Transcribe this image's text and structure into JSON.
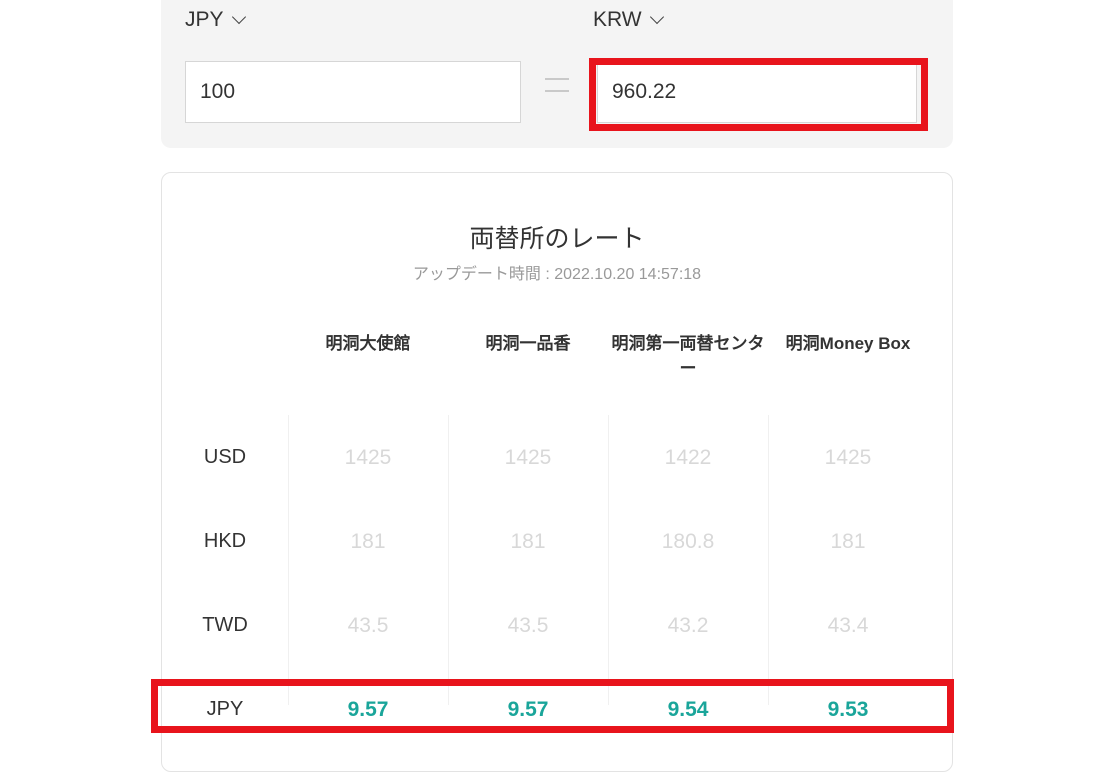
{
  "converter": {
    "from_currency": "JPY",
    "to_currency": "KRW",
    "from_amount": "100",
    "to_amount": "960.22",
    "equals_symbol": "="
  },
  "rates": {
    "title": "両替所のレート",
    "updated": "アップデート時間 : 2022.10.20 14:57:18",
    "exchangers": [
      "明洞大使館",
      "明洞一品香",
      "明洞第一両替センター",
      "明洞Money Box"
    ],
    "rows": [
      {
        "currency": "USD",
        "values": [
          "1425",
          "1425",
          "1422",
          "1425"
        ]
      },
      {
        "currency": "HKD",
        "values": [
          "181",
          "181",
          "180.8",
          "181"
        ]
      },
      {
        "currency": "TWD",
        "values": [
          "43.5",
          "43.5",
          "43.2",
          "43.4"
        ]
      },
      {
        "currency": "JPY",
        "values": [
          "9.57",
          "9.57",
          "9.54",
          "9.53"
        ]
      }
    ]
  },
  "colors": {
    "highlight": "#e8141c",
    "accent": "#1aa59a"
  },
  "icons": [
    "chevron-down-icon"
  ]
}
